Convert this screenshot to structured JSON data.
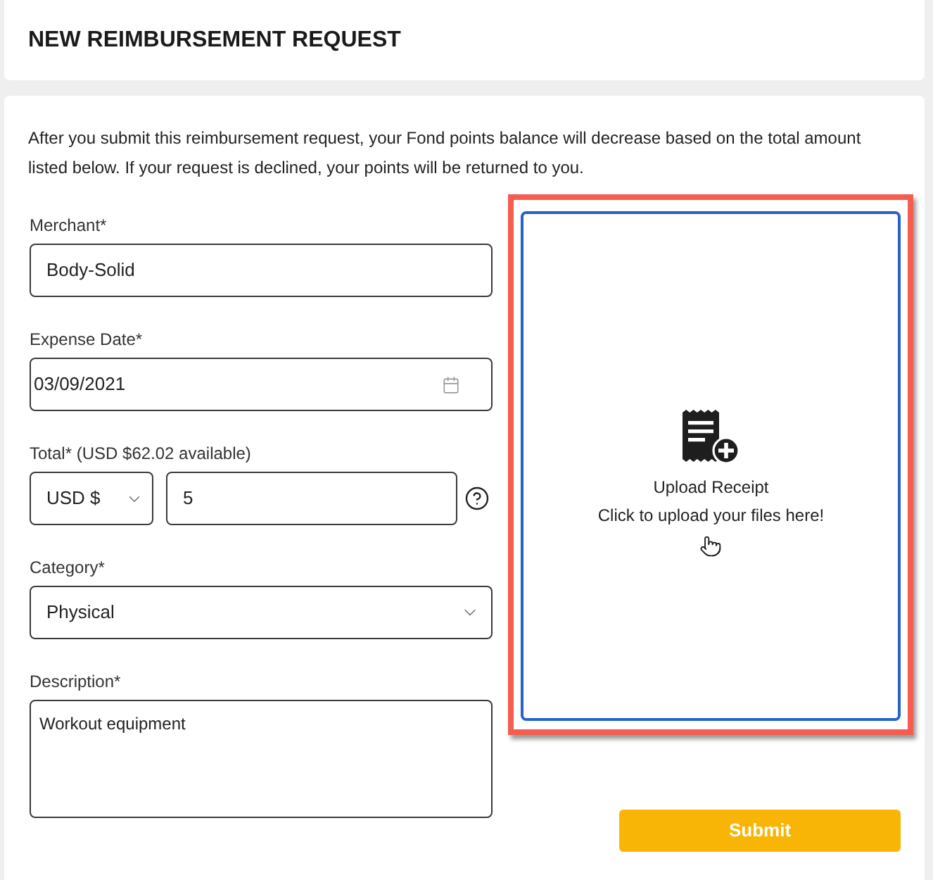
{
  "header": {
    "title": "NEW REIMBURSEMENT REQUEST"
  },
  "form": {
    "intro": "After you submit this reimbursement request, your Fond points balance will decrease based on the total amount listed below. If your request is declined, your points will be returned to you.",
    "fields": [
      {
        "kind": "text",
        "label": "Merchant*",
        "value": "Body-Solid"
      },
      {
        "kind": "date",
        "label": "Expense Date*",
        "value": "03/09/2021"
      },
      {
        "kind": "amount",
        "label": "Total* (USD $62.02 available)",
        "currency": "USD $",
        "value": "5"
      },
      {
        "kind": "select",
        "label": "Category*",
        "value": "Physical"
      },
      {
        "kind": "textarea",
        "label": "Description*",
        "value": "Workout equipment"
      }
    ]
  },
  "upload": {
    "title": "Upload Receipt",
    "hint": "Click to upload your files here!",
    "highlighted": true
  },
  "submit_button": {
    "label": "Submit"
  }
}
